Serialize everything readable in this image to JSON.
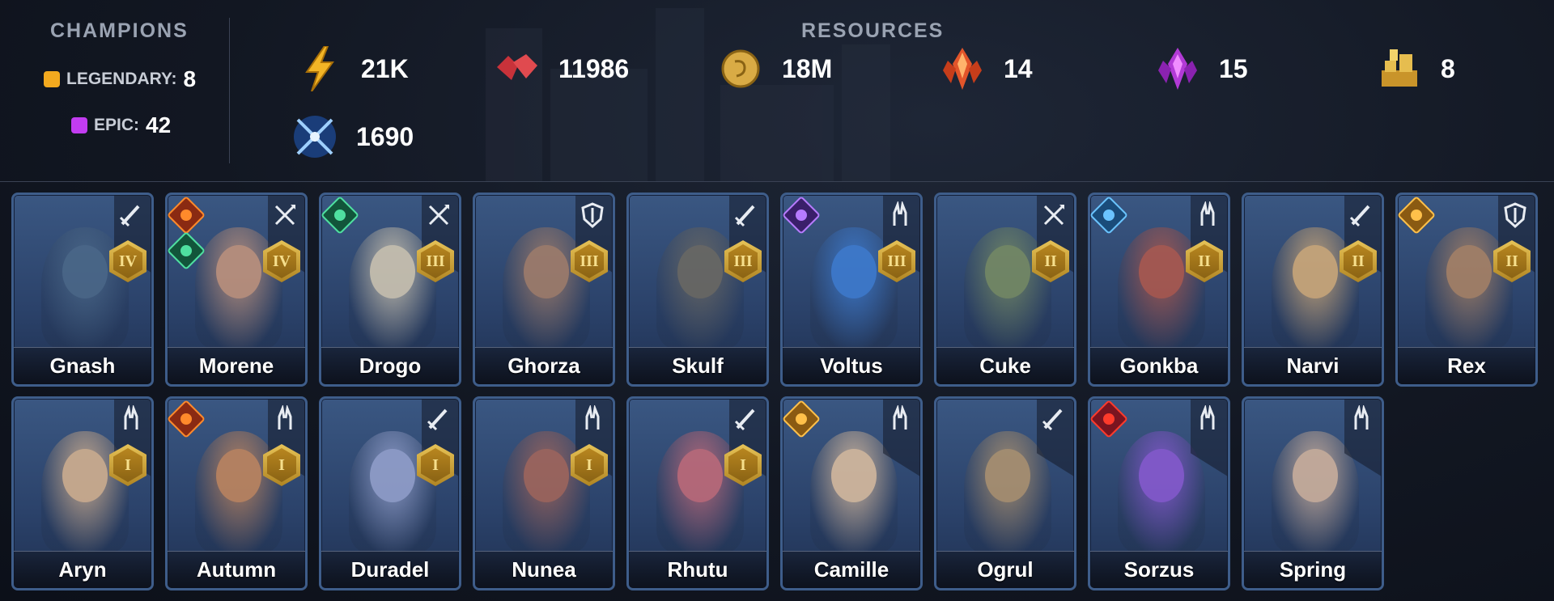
{
  "header": {
    "champions_title": "CHAMPIONS",
    "resources_title": "RESOURCES",
    "legendary": {
      "label": "LEGENDARY:",
      "count": "8",
      "color": "#f2a91f"
    },
    "epic": {
      "label": "EPIC:",
      "count": "42",
      "color": "#c23cf0"
    }
  },
  "resources": [
    {
      "icon": "energy-bolt-icon",
      "value": "21K"
    },
    {
      "icon": "rubies-icon",
      "value": "11986"
    },
    {
      "icon": "silver-coin-icon",
      "value": "18M"
    },
    {
      "icon": "red-shard-icon",
      "value": "14"
    },
    {
      "icon": "purple-shard-icon",
      "value": "15"
    },
    {
      "icon": "gold-bars-icon",
      "value": "8"
    },
    {
      "icon": "arena-tokens-icon",
      "value": "1690"
    }
  ],
  "champions": [
    {
      "name": "Gnash",
      "rank": "IV",
      "role": "attack-icon",
      "affinities": [],
      "skin": "#4d6a8a"
    },
    {
      "name": "Morene",
      "rank": "IV",
      "role": "hp-icon",
      "affinities": [
        "force",
        "magic"
      ],
      "skin": "#c9987e"
    },
    {
      "name": "Drogo",
      "rank": "III",
      "role": "hp-icon",
      "affinities": [
        "magic"
      ],
      "skin": "#d8cdb6"
    },
    {
      "name": "Ghorza",
      "rank": "III",
      "role": "defense-icon",
      "affinities": [],
      "skin": "#a9816a"
    },
    {
      "name": "Skulf",
      "rank": "III",
      "role": "attack-icon",
      "affinities": [],
      "skin": "#6f6b62"
    },
    {
      "name": "Voltus",
      "rank": "III",
      "role": "support-icon",
      "affinities": [
        "void"
      ],
      "skin": "#3f7fd6"
    },
    {
      "name": "Cuke",
      "rank": "II",
      "role": "hp-icon",
      "affinities": [],
      "skin": "#7b8f63"
    },
    {
      "name": "Gonkba",
      "rank": "II",
      "role": "support-icon",
      "affinities": [
        "spirit"
      ],
      "skin": "#b55a4c"
    },
    {
      "name": "Narvi",
      "rank": "II",
      "role": "attack-icon",
      "affinities": [],
      "skin": "#d9b07a"
    },
    {
      "name": "Rex",
      "rank": "II",
      "role": "defense-icon",
      "affinities": [
        "spirit-orange"
      ],
      "skin": "#b08665"
    },
    {
      "name": "Aryn",
      "rank": "I",
      "role": "support-icon",
      "affinities": [],
      "skin": "#dcb792"
    },
    {
      "name": "Autumn",
      "rank": "I",
      "role": "support-icon",
      "affinities": [
        "force"
      ],
      "skin": "#c98a5e"
    },
    {
      "name": "Duradel",
      "rank": "I",
      "role": "attack-icon",
      "affinities": [],
      "skin": "#9aa6d2"
    },
    {
      "name": "Nunea",
      "rank": "I",
      "role": "support-icon",
      "affinities": [],
      "skin": "#a9685a"
    },
    {
      "name": "Rhutu",
      "rank": "I",
      "role": "attack-icon",
      "affinities": [],
      "skin": "#c96d7a"
    },
    {
      "name": "Camille",
      "rank": "",
      "role": "support-icon",
      "affinities": [
        "spirit-orange"
      ],
      "skin": "#e3c3a2"
    },
    {
      "name": "Ogrul",
      "rank": "",
      "role": "attack-icon",
      "affinities": [],
      "skin": "#b59770"
    },
    {
      "name": "Sorzus",
      "rank": "",
      "role": "support-icon",
      "affinities": [
        "force-red"
      ],
      "skin": "#8d5bd6"
    },
    {
      "name": "Spring",
      "rank": "",
      "role": "support-icon",
      "affinities": [],
      "skin": "#d8b8a0"
    }
  ]
}
